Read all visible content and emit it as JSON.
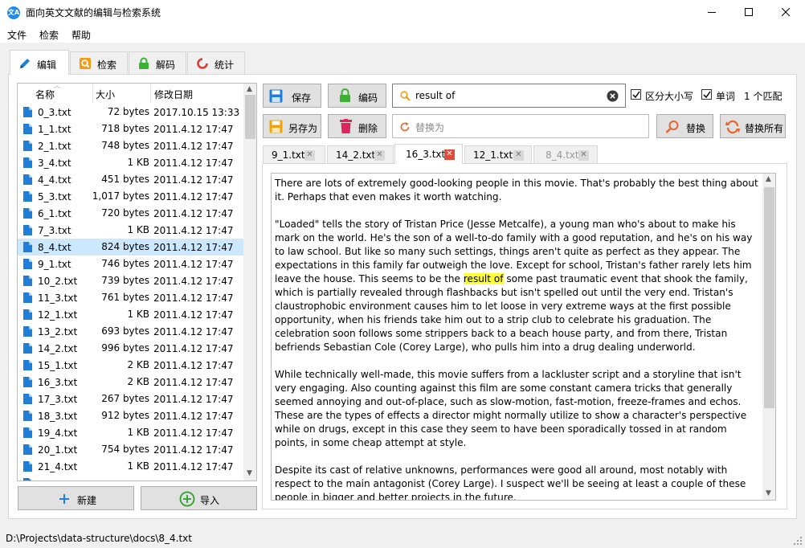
{
  "window": {
    "title": "面向英文文献的编辑与检索系统",
    "icon_text": "文A",
    "buttons": [
      "minimize-icon",
      "maximize-icon",
      "close-icon"
    ]
  },
  "menu": {
    "items": [
      "文件",
      "检索",
      "帮助"
    ]
  },
  "main_tabs": [
    {
      "label": "编辑",
      "icon": "pencil-icon",
      "active": true
    },
    {
      "label": "检索",
      "icon": "search-doc-icon"
    },
    {
      "label": "解码",
      "icon": "lock-icon"
    },
    {
      "label": "统计",
      "icon": "chart-ring-icon"
    }
  ],
  "file_list": {
    "columns": [
      "名称",
      "大小",
      "修改日期"
    ],
    "selected": "8_4.txt",
    "rows": [
      {
        "name": "0_3.txt",
        "size": "72 bytes",
        "date": "2017.10.15 13:33"
      },
      {
        "name": "1_1.txt",
        "size": "718 bytes",
        "date": "2011.4.12 17:47"
      },
      {
        "name": "2_1.txt",
        "size": "748 bytes",
        "date": "2011.4.12 17:47"
      },
      {
        "name": "3_4.txt",
        "size": "1 KB",
        "date": "2011.4.12 17:47"
      },
      {
        "name": "4_4.txt",
        "size": "451 bytes",
        "date": "2011.4.12 17:47"
      },
      {
        "name": "5_3.txt",
        "size": "1,017 bytes",
        "date": "2011.4.12 17:47"
      },
      {
        "name": "6_1.txt",
        "size": "720 bytes",
        "date": "2011.4.12 17:47"
      },
      {
        "name": "7_3.txt",
        "size": "1 KB",
        "date": "2011.4.12 17:47"
      },
      {
        "name": "8_4.txt",
        "size": "824 bytes",
        "date": "2011.4.12 17:47"
      },
      {
        "name": "9_1.txt",
        "size": "746 bytes",
        "date": "2011.4.12 17:47"
      },
      {
        "name": "10_2.txt",
        "size": "739 bytes",
        "date": "2011.4.12 17:47"
      },
      {
        "name": "11_3.txt",
        "size": "761 bytes",
        "date": "2011.4.12 17:47"
      },
      {
        "name": "12_1.txt",
        "size": "1 KB",
        "date": "2011.4.12 17:47"
      },
      {
        "name": "13_2.txt",
        "size": "693 bytes",
        "date": "2011.4.12 17:47"
      },
      {
        "name": "14_2.txt",
        "size": "996 bytes",
        "date": "2011.4.12 17:47"
      },
      {
        "name": "15_1.txt",
        "size": "2 KB",
        "date": "2011.4.12 17:47"
      },
      {
        "name": "16_3.txt",
        "size": "2 KB",
        "date": "2011.4.12 17:47"
      },
      {
        "name": "17_3.txt",
        "size": "267 bytes",
        "date": "2011.4.12 17:47"
      },
      {
        "name": "18_3.txt",
        "size": "912 bytes",
        "date": "2011.4.12 17:47"
      },
      {
        "name": "19_4.txt",
        "size": "1 KB",
        "date": "2011.4.12 17:47"
      },
      {
        "name": "20_1.txt",
        "size": "754 bytes",
        "date": "2011.4.12 17:47"
      },
      {
        "name": "21_4.txt",
        "size": "1 KB",
        "date": "2011.4.12 17:47"
      }
    ]
  },
  "left_buttons": {
    "new": "新建",
    "import": "导入"
  },
  "toolbar": {
    "save": "保存",
    "encode": "编码",
    "save_as": "另存为",
    "delete": "删除",
    "replace": "替换",
    "replace_all": "替换所有",
    "search_value": "result of",
    "replace_placeholder": "替换为",
    "case_sensitive": "区分大小写",
    "whole_word": "单词",
    "match_count": "1 个匹配"
  },
  "doc_tabs": [
    {
      "label": "9_1.txt"
    },
    {
      "label": "14_2.txt"
    },
    {
      "label": "16_3.txt",
      "active": true
    },
    {
      "label": "12_1.txt"
    },
    {
      "label": "8_4.txt",
      "dim": true
    }
  ],
  "editor": {
    "p1": "There are lots of extremely good-looking people in this movie. That's probably the best thing about it. Perhaps that even makes it worth watching.",
    "p2_before": "\"Loaded\" tells the story of Tristan Price (Jesse Metcalfe), a young man who's about to make his mark on the world. He's the son of a well-to-do family with a good reputation, and he's on his way to law school. But like so many such settings, things aren't quite as perfect as they appear. The expectations in this family far outweigh the love. Except for school, Tristan's father rarely lets him leave the house. This seems to be the ",
    "p2_match": "result of",
    "p2_after": " some past traumatic event that shook the family, which is partially revealed through flashbacks but isn't spelled out until the very end. Tristan's claustrophobic environment causes him to let loose in very extreme ways at the first possible opportunity, when his friends take him out to a strip club to celebrate his graduation. The celebration soon follows some strippers back to a beach house party, and from there, Tristan befriends Sebastian Cole (Corey Large), who pulls him into a drug dealing underworld.",
    "p3": "While technically well-made, this movie suffers from a lackluster script and a storyline that isn't very engaging. Also counting against this film are some constant camera tricks that generally seemed annoying and out-of-place, such as slow-motion, fast-motion, freeze-frames and echos. These are the types of effects a director might normally utilize to show a character's perspective while on drugs, except in this case they seem to have been sporadically tossed in at random points, in some cheap attempt at style.",
    "p4": "Despite its cast of relative unknowns, performances were good all around, most notably with respect to the main antagonist (Corey Large). I suspect we'll be seeing at least a couple of these people in bigger and better projects in the future."
  },
  "status": {
    "path": "D:\\Projects\\data-structure\\docs\\8_4.txt"
  }
}
